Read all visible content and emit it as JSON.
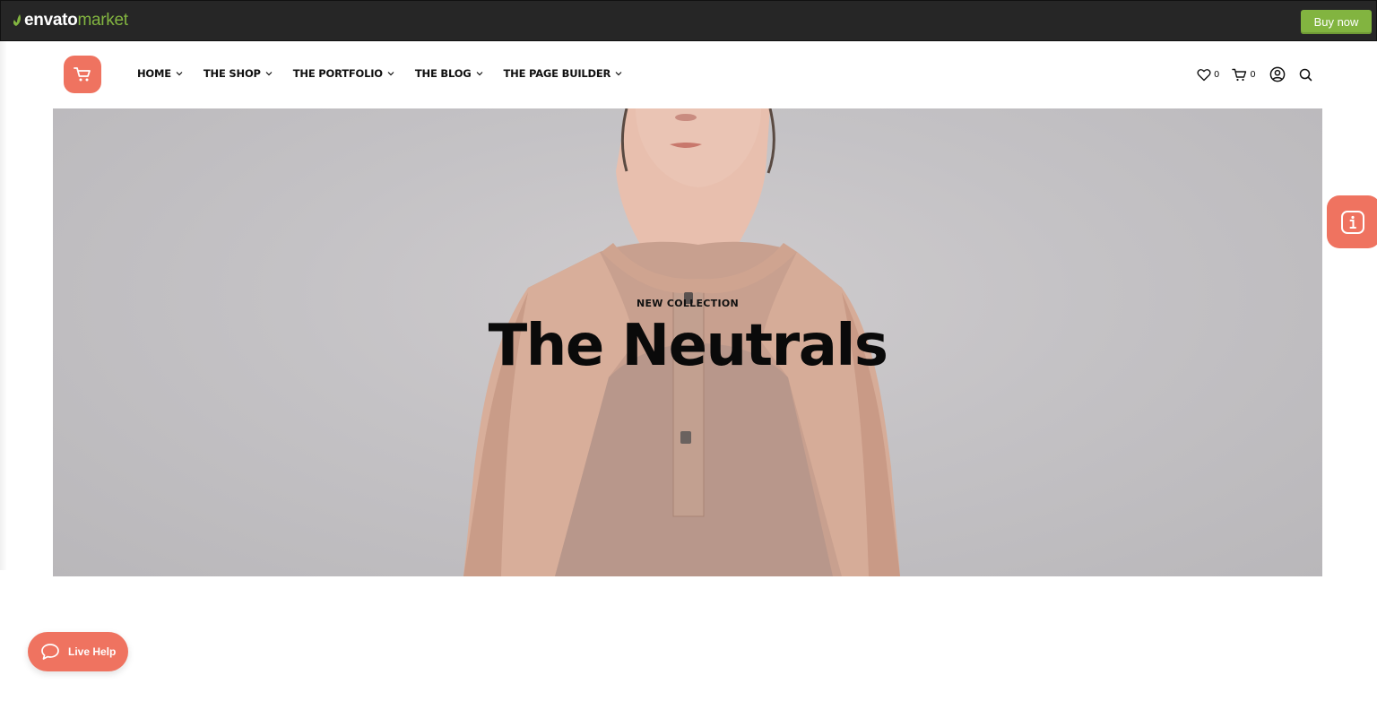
{
  "envato_bar": {
    "logo_part1": "envato",
    "logo_part2": "market",
    "buy_label": "Buy now",
    "accent": "#82b440",
    "background": "#262626"
  },
  "header": {
    "logo_icon": "cart-icon",
    "nav": [
      {
        "label": "HOME"
      },
      {
        "label": "THE SHOP"
      },
      {
        "label": "THE PORTFOLIO"
      },
      {
        "label": "THE BLOG"
      },
      {
        "label": "THE PAGE BUILDER"
      }
    ],
    "wishlist_count": "0",
    "cart_count": "0",
    "brand_color": "#ef7360"
  },
  "hero": {
    "eyebrow": "NEW COLLECTION",
    "title": "The Neutrals"
  },
  "live_help": {
    "label": "Live Help"
  }
}
